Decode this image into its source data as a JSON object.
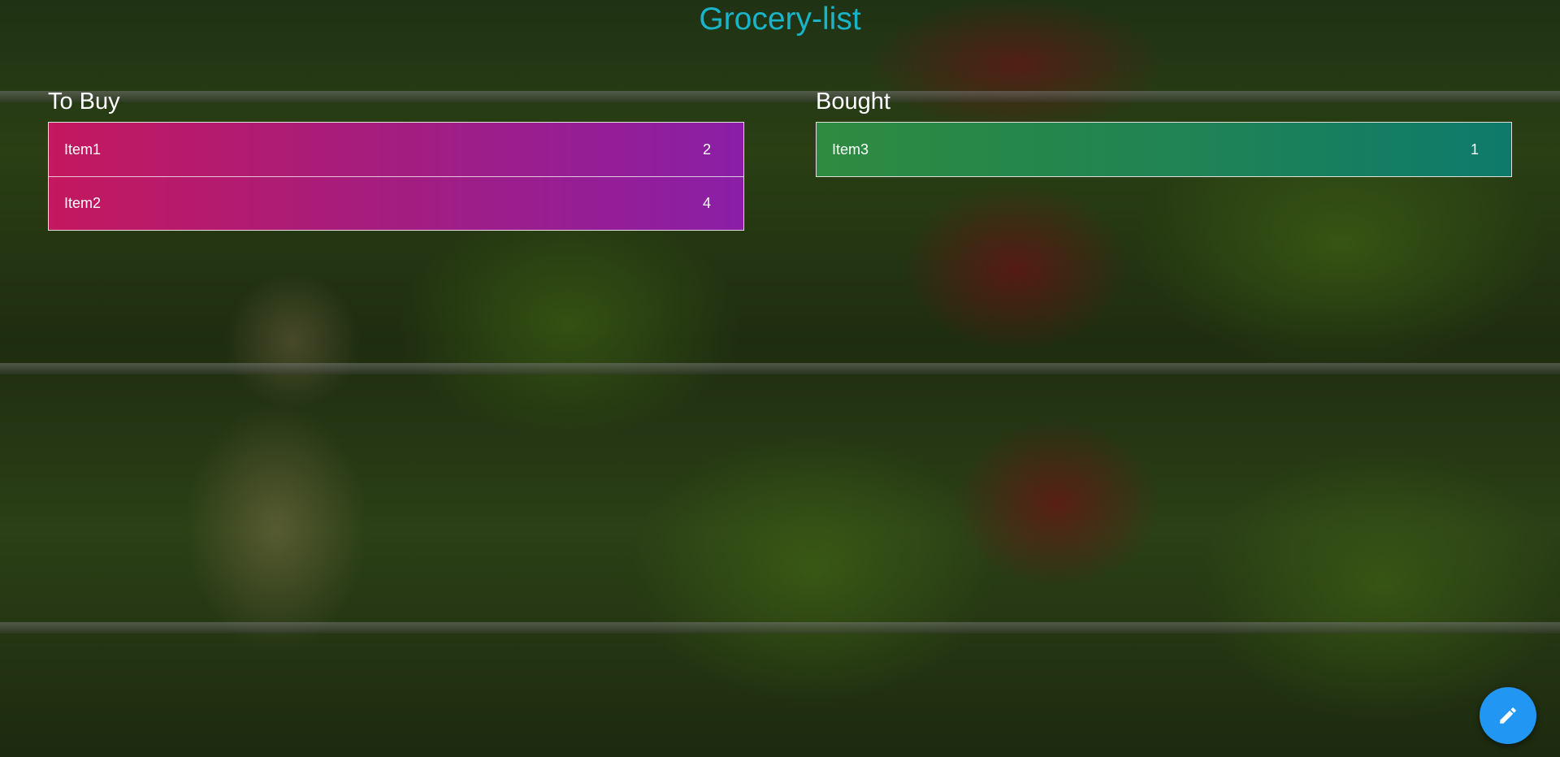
{
  "app": {
    "title": "Grocery-list"
  },
  "to_buy": {
    "heading": "To Buy",
    "items": [
      {
        "name": "Item1",
        "quantity": "2"
      },
      {
        "name": "Item2",
        "quantity": "4"
      }
    ]
  },
  "bought": {
    "heading": "Bought",
    "items": [
      {
        "name": "Item3",
        "quantity": "1"
      }
    ]
  },
  "fab": {
    "icon": "pencil-icon"
  },
  "colors": {
    "title": "#1ab4c9",
    "to_buy_gradient_start": "#c4185f",
    "to_buy_gradient_end": "#8a1fa6",
    "bought_gradient_start": "#2e8b3f",
    "bought_gradient_end": "#0e7a6b",
    "fab": "#2196f3"
  }
}
